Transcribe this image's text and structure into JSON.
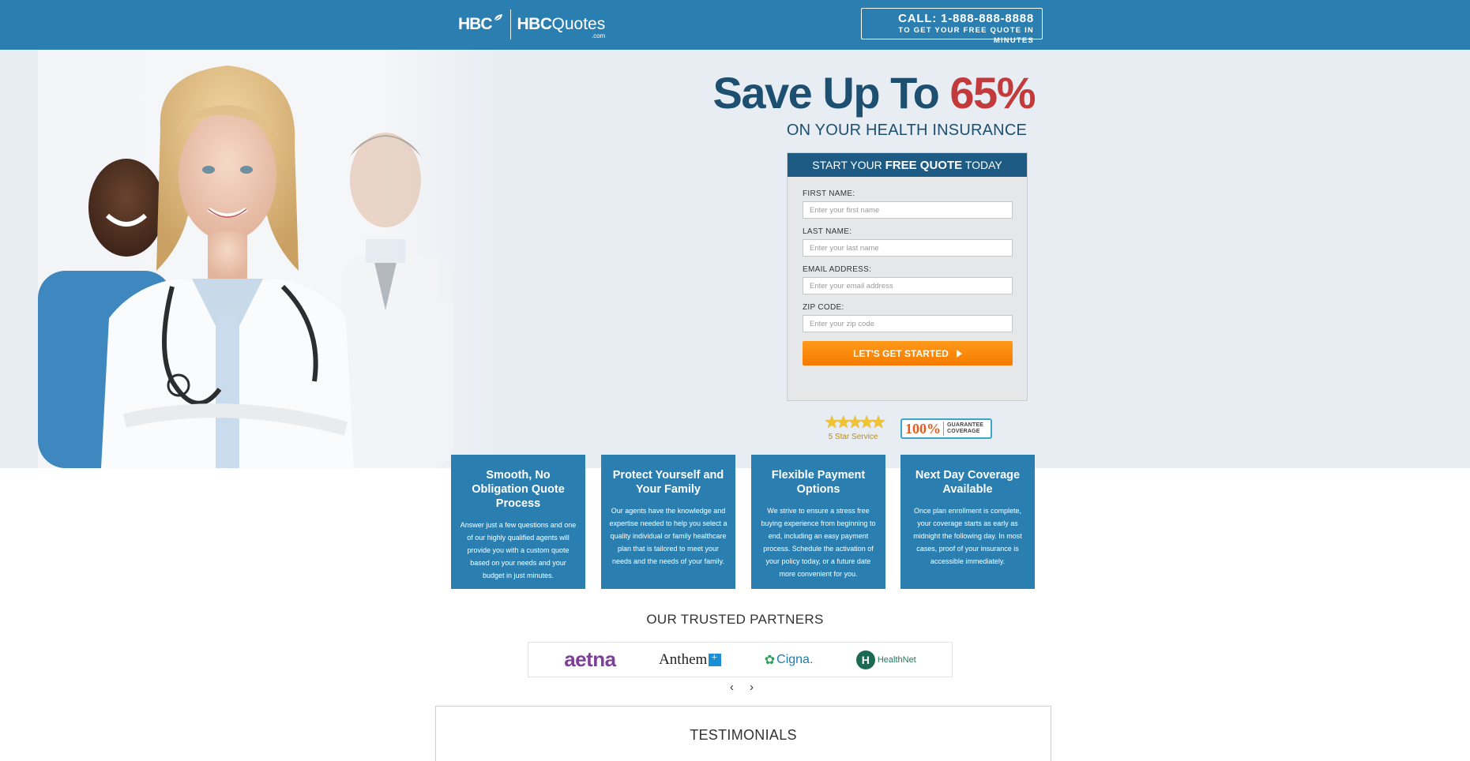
{
  "header": {
    "logo_mark": "HBC",
    "brand_bold": "HBC",
    "brand_light": "Quotes",
    "brand_suffix": ".com",
    "call_line": "CALL: 1-888-888-8888",
    "call_sub": "TO GET YOUR FREE QUOTE IN MINUTES",
    "color": "#2b7fb0"
  },
  "hero": {
    "headline_prefix": "Save Up To",
    "headline_percent": "65%",
    "subheadline": "ON YOUR HEALTH INSURANCE",
    "headline_color": "#1d4f70",
    "accent_color": "#c23a3b"
  },
  "form": {
    "title_prefix": "START YOUR",
    "title_bold": "FREE QUOTE",
    "title_suffix": "TODAY",
    "fields": [
      {
        "label": "FIRST NAME:",
        "placeholder": "Enter your first name",
        "value": ""
      },
      {
        "label": "LAST NAME:",
        "placeholder": "Enter your last name",
        "value": ""
      },
      {
        "label": "EMAIL ADDRESS:",
        "placeholder": "Enter your email address",
        "value": ""
      },
      {
        "label": "ZIP CODE:",
        "placeholder": "Enter your zip code",
        "value": ""
      }
    ],
    "submit_label": "LET'S GET STARTED",
    "submit_color": "#f67b00"
  },
  "badges": {
    "stars_label": "5 Star Service",
    "guarantee_percent": "100%",
    "guarantee_line1": "GUARANTEE",
    "guarantee_line2": "COVERAGE"
  },
  "features": [
    {
      "title": "Smooth, No Obligation Quote Process",
      "text": "Answer just a few questions and one of our highly qualified agents will provide you with a custom quote based on your needs and your budget in just minutes."
    },
    {
      "title": "Protect Yourself and Your Family",
      "text": "Our agents have the knowledge and expertise needed to help you select a quality individual or family healthcare plan that is tailored to meet your needs and the needs of your family."
    },
    {
      "title": "Flexible Payment Options",
      "text": "We strive to ensure a stress free buying experience from beginning to end, including an easy payment process. Schedule the activation of your policy today, or a future date more convenient for you."
    },
    {
      "title": "Next Day Coverage Available",
      "text": "Once plan enrollment is complete, your coverage starts as early as midnight the following day. In most cases, proof of your insurance is accessible immediately."
    }
  ],
  "partners": {
    "title": "OUR TRUSTED PARTNERS",
    "logos": [
      "aetna",
      "Anthem",
      "Cigna.",
      "HealthNet"
    ]
  },
  "testimonials": {
    "title": "TESTIMONIALS"
  }
}
